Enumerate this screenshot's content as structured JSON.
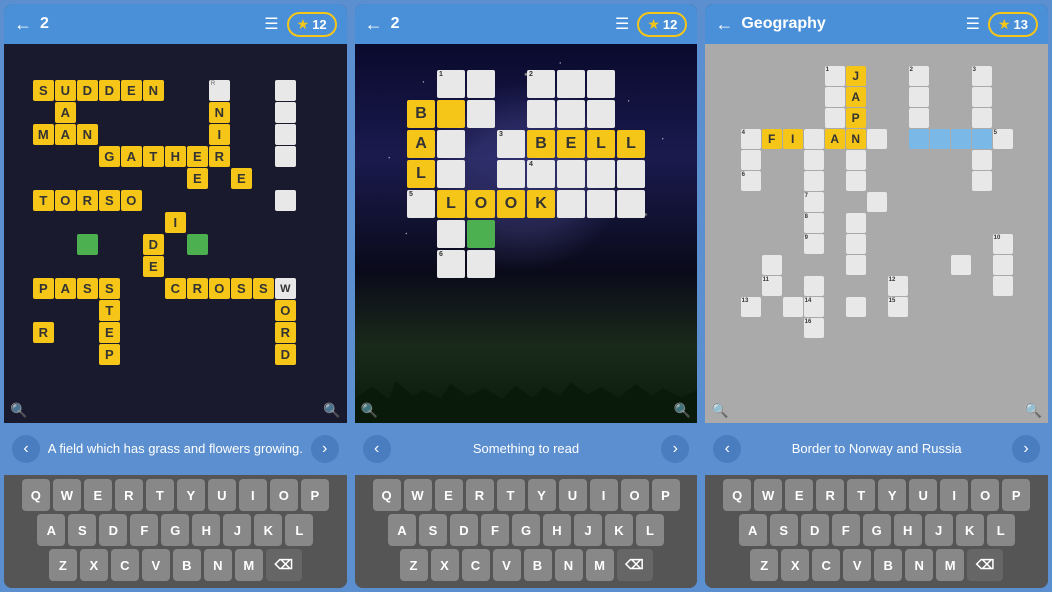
{
  "panels": [
    {
      "id": "panel-1",
      "header": {
        "level": "2",
        "menu_icon": "☰",
        "star_count": "12"
      },
      "clue": "A field which has grass and flowers growing.",
      "keyboard_rows": [
        [
          "Q",
          "W",
          "E",
          "R",
          "T",
          "Y",
          "U",
          "I",
          "O",
          "P"
        ],
        [
          "A",
          "S",
          "D",
          "F",
          "G",
          "H",
          "J",
          "K",
          "L"
        ],
        [
          "Z",
          "X",
          "C",
          "V",
          "B",
          "N",
          "M",
          "⌫"
        ]
      ]
    },
    {
      "id": "panel-2",
      "header": {
        "level": "2",
        "menu_icon": "☰",
        "star_count": "12"
      },
      "clue": "Something to read",
      "keyboard_rows": [
        [
          "Q",
          "W",
          "E",
          "R",
          "T",
          "Y",
          "U",
          "I",
          "O",
          "P"
        ],
        [
          "A",
          "S",
          "D",
          "F",
          "G",
          "H",
          "J",
          "K",
          "L"
        ],
        [
          "Z",
          "X",
          "C",
          "V",
          "B",
          "N",
          "M",
          "⌫"
        ]
      ]
    },
    {
      "id": "panel-3",
      "header": {
        "level": "Geography",
        "menu_icon": "☰",
        "star_count": "13"
      },
      "clue": "Border to Norway and Russia",
      "keyboard_rows": [
        [
          "Q",
          "W",
          "E",
          "R",
          "T",
          "Y",
          "U",
          "I",
          "O",
          "P"
        ],
        [
          "A",
          "S",
          "D",
          "F",
          "G",
          "H",
          "J",
          "K",
          "L"
        ],
        [
          "Z",
          "X",
          "C",
          "V",
          "B",
          "N",
          "M",
          "⌫"
        ]
      ]
    }
  ],
  "icons": {
    "back": "←",
    "zoom_in": "🔍",
    "zoom_out": "🔍",
    "nav_prev": "‹",
    "nav_next": "›",
    "star": "★"
  }
}
